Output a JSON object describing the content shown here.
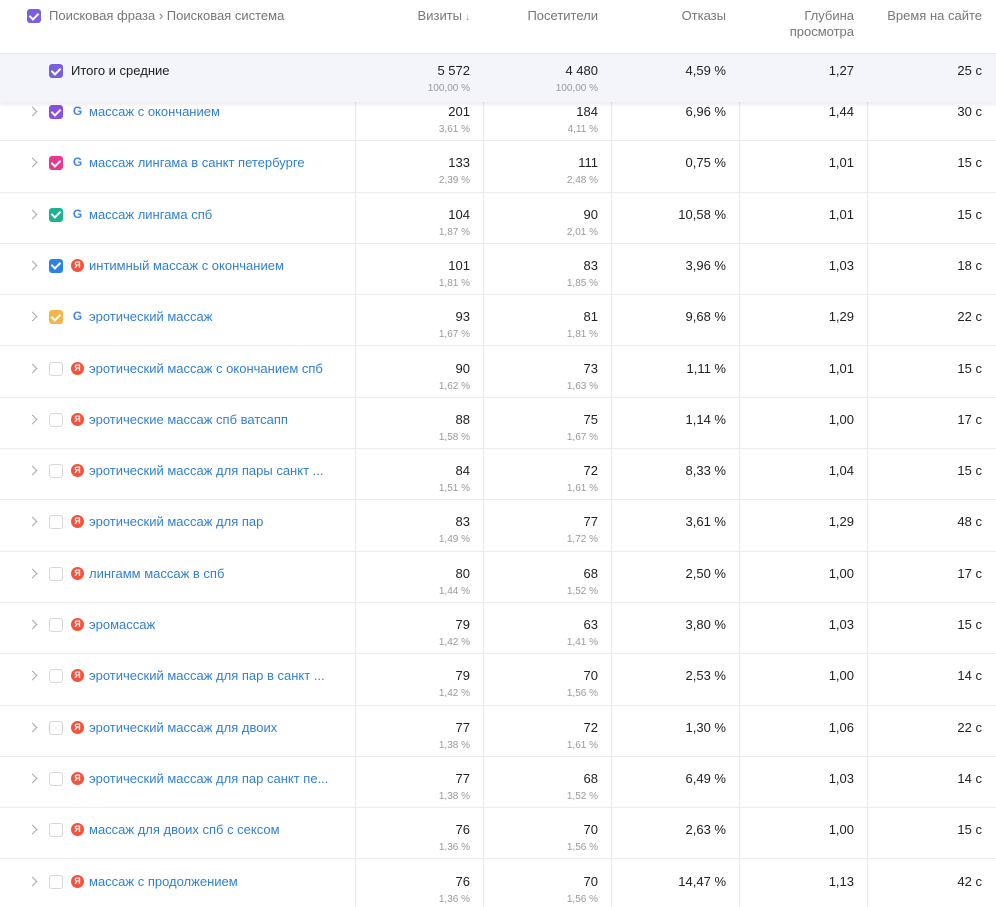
{
  "header": {
    "dimension_label": "Поисковая фраза › Поисковая система",
    "columns": [
      "Визиты",
      "Посетители",
      "Отказы",
      "Глубина просмотра",
      "Время на сайте"
    ],
    "sort_arrow": "↓",
    "checkbox_color": "#7b5ee0"
  },
  "totals": {
    "label": "Итого и средние",
    "visits": "5 572",
    "visits_pct": "100,00 %",
    "visitors": "4 480",
    "visitors_pct": "100,00 %",
    "bounce": "4,59 %",
    "depth": "1,27",
    "time": "25 с",
    "checkbox_color": "#7b5ee0"
  },
  "rows": [
    {
      "phrase": "массаж с окончанием",
      "engine": "google",
      "checked": true,
      "color": "#8a4fe0",
      "visits": "201",
      "visits_pct": "3,61 %",
      "visitors": "184",
      "visitors_pct": "4,11 %",
      "bounce": "6,96 %",
      "depth": "1,44",
      "time": "30 с"
    },
    {
      "phrase": "массаж лингама в санкт петербурге",
      "engine": "google",
      "checked": true,
      "color": "#e8378e",
      "visits": "133",
      "visits_pct": "2,39 %",
      "visitors": "111",
      "visitors_pct": "2,48 %",
      "bounce": "0,75 %",
      "depth": "1,01",
      "time": "15 с"
    },
    {
      "phrase": "массаж лингама спб",
      "engine": "google",
      "checked": true,
      "color": "#1bb394",
      "visits": "104",
      "visits_pct": "1,87 %",
      "visitors": "90",
      "visitors_pct": "2,01 %",
      "bounce": "10,58 %",
      "depth": "1,01",
      "time": "15 с"
    },
    {
      "phrase": "интимный массаж с окончанием",
      "engine": "yandex",
      "checked": true,
      "color": "#2b83e5",
      "visits": "101",
      "visits_pct": "1,81 %",
      "visitors": "83",
      "visitors_pct": "1,85 %",
      "bounce": "3,96 %",
      "depth": "1,03",
      "time": "18 с"
    },
    {
      "phrase": "эротический массаж",
      "engine": "google",
      "checked": true,
      "color": "#f5b54a",
      "visits": "93",
      "visits_pct": "1,67 %",
      "visitors": "81",
      "visitors_pct": "1,81 %",
      "bounce": "9,68 %",
      "depth": "1,29",
      "time": "22 с"
    },
    {
      "phrase": "эротический массаж с окончанием спб",
      "engine": "yandex",
      "checked": false,
      "color": "",
      "visits": "90",
      "visits_pct": "1,62 %",
      "visitors": "73",
      "visitors_pct": "1,63 %",
      "bounce": "1,11 %",
      "depth": "1,01",
      "time": "15 с"
    },
    {
      "phrase": "эротические массаж спб ватсапп",
      "engine": "yandex",
      "checked": false,
      "color": "",
      "visits": "88",
      "visits_pct": "1,58 %",
      "visitors": "75",
      "visitors_pct": "1,67 %",
      "bounce": "1,14 %",
      "depth": "1,00",
      "time": "17 с"
    },
    {
      "phrase": "эротический массаж для пары санкт ...",
      "engine": "yandex",
      "checked": false,
      "color": "",
      "visits": "84",
      "visits_pct": "1,51 %",
      "visitors": "72",
      "visitors_pct": "1,61 %",
      "bounce": "8,33 %",
      "depth": "1,04",
      "time": "15 с"
    },
    {
      "phrase": "эротический массаж для пар",
      "engine": "yandex",
      "checked": false,
      "color": "",
      "visits": "83",
      "visits_pct": "1,49 %",
      "visitors": "77",
      "visitors_pct": "1,72 %",
      "bounce": "3,61 %",
      "depth": "1,29",
      "time": "48 с"
    },
    {
      "phrase": "лингамм массаж в спб",
      "engine": "yandex",
      "checked": false,
      "color": "",
      "visits": "80",
      "visits_pct": "1,44 %",
      "visitors": "68",
      "visitors_pct": "1,52 %",
      "bounce": "2,50 %",
      "depth": "1,00",
      "time": "17 с"
    },
    {
      "phrase": "эромассаж",
      "engine": "yandex",
      "checked": false,
      "color": "",
      "visits": "79",
      "visits_pct": "1,42 %",
      "visitors": "63",
      "visitors_pct": "1,41 %",
      "bounce": "3,80 %",
      "depth": "1,03",
      "time": "15 с"
    },
    {
      "phrase": "эротический массаж для пар в санкт ...",
      "engine": "yandex",
      "checked": false,
      "color": "",
      "visits": "79",
      "visits_pct": "1,42 %",
      "visitors": "70",
      "visitors_pct": "1,56 %",
      "bounce": "2,53 %",
      "depth": "1,00",
      "time": "14 с"
    },
    {
      "phrase": "эротический массаж для двоих",
      "engine": "yandex",
      "checked": false,
      "color": "",
      "visits": "77",
      "visits_pct": "1,38 %",
      "visitors": "72",
      "visitors_pct": "1,61 %",
      "bounce": "1,30 %",
      "depth": "1,06",
      "time": "22 с"
    },
    {
      "phrase": "эротический массаж для пар санкт пе...",
      "engine": "yandex",
      "checked": false,
      "color": "",
      "visits": "77",
      "visits_pct": "1,38 %",
      "visitors": "68",
      "visitors_pct": "1,52 %",
      "bounce": "6,49 %",
      "depth": "1,03",
      "time": "14 с"
    },
    {
      "phrase": "массаж для двоих спб с сексом",
      "engine": "yandex",
      "checked": false,
      "color": "",
      "visits": "76",
      "visits_pct": "1,36 %",
      "visitors": "70",
      "visitors_pct": "1,56 %",
      "bounce": "2,63 %",
      "depth": "1,00",
      "time": "15 с"
    },
    {
      "phrase": "массаж с продолжением",
      "engine": "yandex",
      "checked": false,
      "color": "",
      "visits": "76",
      "visits_pct": "1,36 %",
      "visitors": "70",
      "visitors_pct": "1,56 %",
      "bounce": "14,47 %",
      "depth": "1,13",
      "time": "42 с"
    }
  ],
  "engine_icons": {
    "google": "G",
    "yandex": "Я"
  },
  "colors": {
    "link": "#3281cd",
    "yandex": "#f3533e",
    "google": "#4285f4",
    "totals_bg": "#f3f5fa"
  }
}
